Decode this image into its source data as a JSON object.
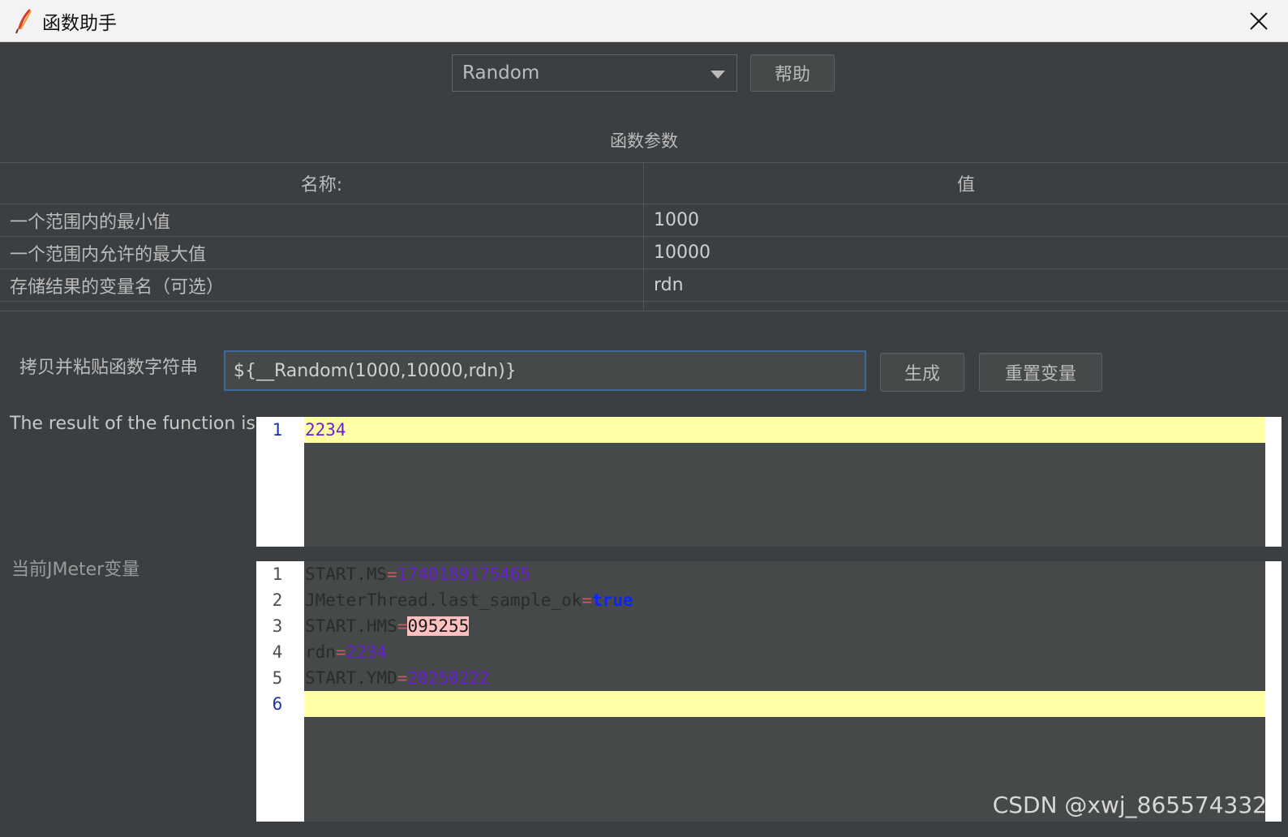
{
  "window": {
    "title": "函数助手"
  },
  "toolbar": {
    "function_select_value": "Random",
    "help_label": "帮助"
  },
  "params": {
    "section_label": "函数参数",
    "header_name": "名称:",
    "header_value": "值",
    "rows": [
      {
        "name": "一个范围内的最小值",
        "value": "1000"
      },
      {
        "name": "一个范围内允许的最大值",
        "value": "10000"
      },
      {
        "name": "存储结果的变量名（可选）",
        "value": "rdn"
      }
    ]
  },
  "function_string": {
    "label": "拷贝并粘贴函数字符串",
    "value": "${__Random(1000,10000,rdn)}",
    "generate_label": "生成",
    "reset_label": "重置变量"
  },
  "result": {
    "label": "The result of the function is",
    "lines": [
      {
        "num": "1",
        "text": "2234"
      }
    ]
  },
  "variables": {
    "label": "当前JMeter变量",
    "lines": [
      {
        "num": "1",
        "key": "START.MS",
        "eq": "=",
        "value": "1740189175465"
      },
      {
        "num": "2",
        "key": "JMeterThread.last_sample_ok",
        "eq": "=",
        "value": "true"
      },
      {
        "num": "3",
        "key": "START.HMS",
        "eq": "=",
        "value": "095255"
      },
      {
        "num": "4",
        "key": "rdn",
        "eq": "=",
        "value": "2234"
      },
      {
        "num": "5",
        "key": "START.YMD",
        "eq": "=",
        "value": "20250222"
      },
      {
        "num": "6",
        "key": "",
        "eq": "",
        "value": ""
      }
    ]
  },
  "watermark": "CSDN @xwj_865574332",
  "colors": {
    "background": "#3c3f41",
    "current_line": "#ffffa6",
    "number_literal": "#6a1fd1",
    "keyword": "#0d24ff",
    "input_focus_border": "#3d6a99"
  }
}
